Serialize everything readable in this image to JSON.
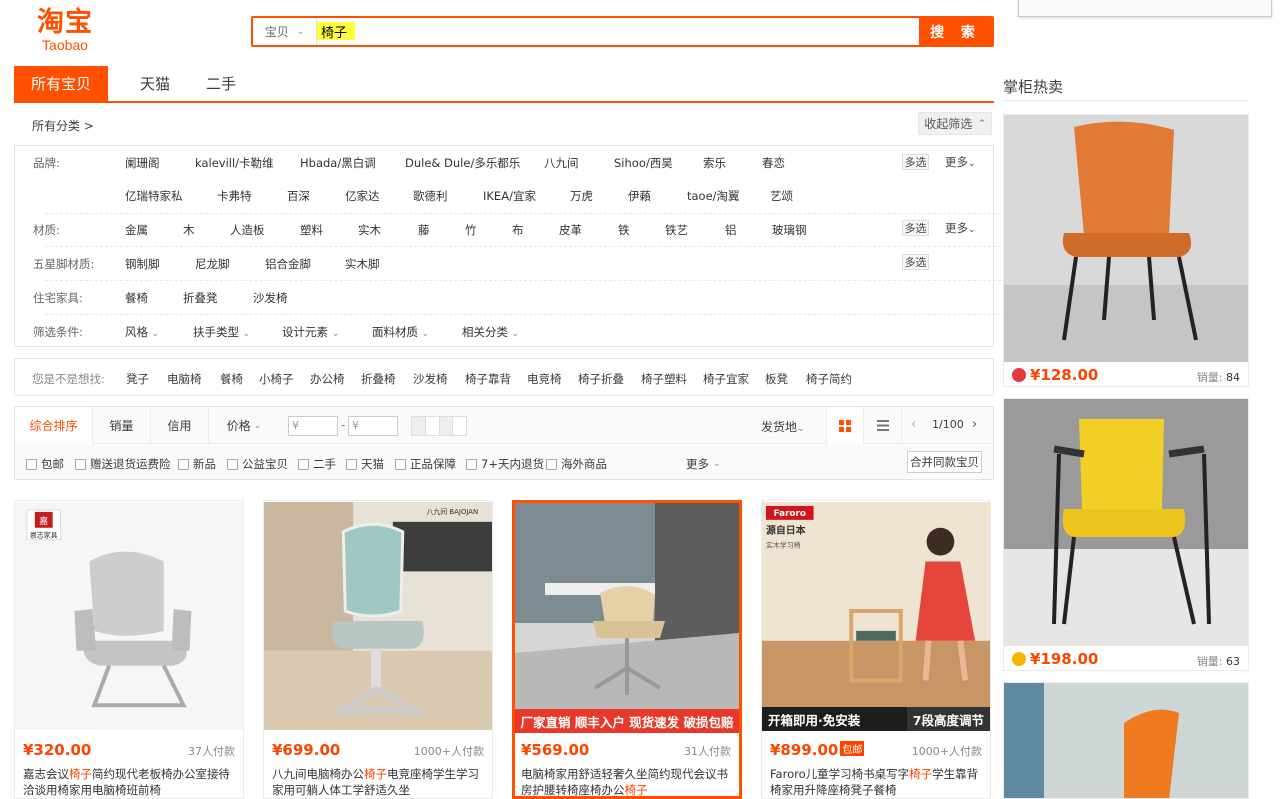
{
  "logo": {
    "cn": "淘宝",
    "en": "Taobao"
  },
  "search": {
    "scope": "宝贝",
    "query": "椅子",
    "button": "搜 索"
  },
  "tabs": [
    "所有宝贝",
    "天猫",
    "二手"
  ],
  "category": {
    "all": "所有分类",
    "collapse": "收起筛选"
  },
  "filters": {
    "brand_label": "品牌:",
    "brands_row1": [
      "阑珊阁",
      "kalevill/卡勒维",
      "Hbada/黑白调",
      "Dule& Dule/多乐都乐",
      "八九间",
      "Sihoo/西昊",
      "索乐",
      "春恋"
    ],
    "brands_row2": [
      "亿瑞特家私",
      "卡弗特",
      "百深",
      "亿家达",
      "歌德利",
      "IKEA/宜家",
      "万虎",
      "伊藾",
      "taoe/淘翼",
      "艺颂"
    ],
    "material_label": "材质:",
    "materials": [
      "金属",
      "木",
      "人造板",
      "塑料",
      "实木",
      "藤",
      "竹",
      "布",
      "皮革",
      "铁",
      "铁艺",
      "铝",
      "玻璃钢"
    ],
    "star_label": "五星脚材质:",
    "stars": [
      "钢制脚",
      "尼龙脚",
      "铝合金脚",
      "实木脚"
    ],
    "home_label": "住宅家具:",
    "homes": [
      "餐椅",
      "折叠凳",
      "沙发椅"
    ],
    "cond_label": "筛选条件:",
    "conds": [
      "风格",
      "扶手类型",
      "设计元素",
      "面料材质",
      "相关分类"
    ],
    "multi": "多选",
    "more": "更多"
  },
  "suggest": {
    "label": "您是不是想找:",
    "items": [
      "凳子",
      "电脑椅",
      "餐椅",
      "小椅子",
      "办公椅",
      "折叠椅",
      "沙发椅",
      "椅子靠背",
      "电竞椅",
      "椅子折叠",
      "椅子塑料",
      "椅子宜家",
      "板凳",
      "椅子简约"
    ]
  },
  "sort": {
    "items": [
      "综合排序",
      "销量",
      "信用",
      "价格"
    ],
    "price_ph": "¥",
    "ship": "发货地",
    "page": "1/100",
    "checks": [
      "包邮",
      "赠送退货运费险",
      "新品",
      "公益宝贝",
      "二手",
      "天猫",
      "正品保障",
      "7+天内退货",
      "海外商品"
    ],
    "more": "更多",
    "merge": "合并同款宝贝"
  },
  "products": [
    {
      "price": "¥320.00",
      "sold": "37人付款",
      "title_a": "嘉志会议",
      "kw": "椅子",
      "title_b": "简约现代老板椅办公室接待洽谈用椅家用电脑椅班前椅",
      "brand": "嘉志家具"
    },
    {
      "price": "¥699.00",
      "sold": "1000+人付款",
      "title_a": "八九间电脑椅办公",
      "kw": "椅子",
      "title_b": "电竞座椅学生学习家用可躺人体工学舒适久坐",
      "brand": "八九间 BAJOJAN"
    },
    {
      "price": "¥569.00",
      "sold": "31人付款",
      "title_a": "电脑椅家用舒适轻奢久坐简约现代会议书房护腰转椅座椅办公",
      "kw": "椅子",
      "title_b": "",
      "banner": "厂家直销 顺丰入户 现货速发 破损包赔"
    },
    {
      "price": "¥899.00",
      "sold": "1000+人付款",
      "title_a": "Faroro儿童学习椅书桌写字",
      "kw": "椅子",
      "title_b": "学生靠背椅家用升降座椅凳子餐椅",
      "tag": "包邮",
      "brand": "Faroro",
      "origin": "源自日本",
      "subtitle": "实木学习椅",
      "banner_l": "开箱即用·免安装",
      "banner_r": "7段高度调节"
    }
  ],
  "right": {
    "title": "掌柜热卖",
    "items": [
      {
        "price": "¥128.00",
        "sold_label": "销量:",
        "sold": "84"
      },
      {
        "price": "¥198.00",
        "sold_label": "销量:",
        "sold": "63"
      }
    ]
  },
  "colors": {
    "accent": "#ff5000",
    "price": "#ff4400"
  }
}
